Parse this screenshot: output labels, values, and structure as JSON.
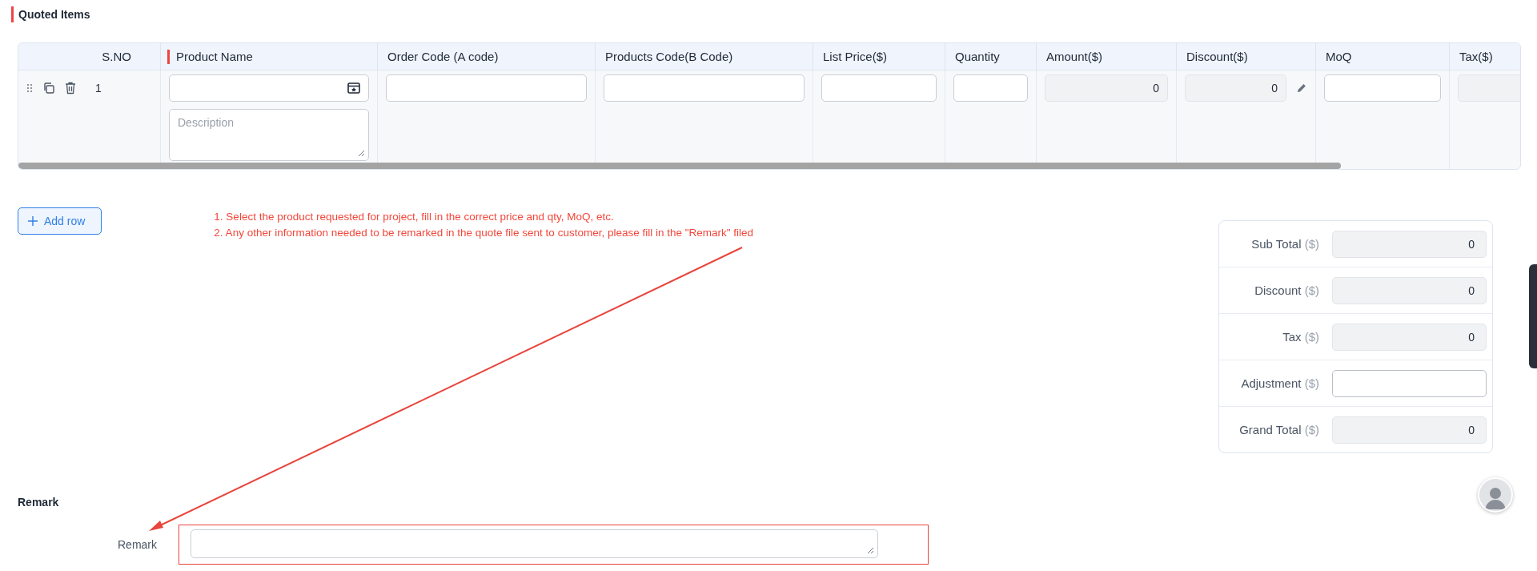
{
  "section_title": "Quoted Items",
  "table": {
    "columns": [
      {
        "label": "S.NO",
        "required": false
      },
      {
        "label": "Product Name",
        "required": true
      },
      {
        "label": "Order Code (A code)",
        "required": false
      },
      {
        "label": "Products Code(B Code)",
        "required": false
      },
      {
        "label": "List Price($)",
        "required": false
      },
      {
        "label": "Quantity",
        "required": false
      },
      {
        "label": "Amount($)",
        "required": false
      },
      {
        "label": "Discount($)",
        "required": false
      },
      {
        "label": "MoQ",
        "required": false
      },
      {
        "label": "Tax($)",
        "required": false
      }
    ],
    "rows": [
      {
        "cells": [
          {
            "kind": "sno",
            "value": "1"
          },
          {
            "kind": "product",
            "placeholder": "Description"
          },
          {
            "kind": "input"
          },
          {
            "kind": "input"
          },
          {
            "kind": "input"
          },
          {
            "kind": "input"
          },
          {
            "kind": "readonly",
            "value": "0"
          },
          {
            "kind": "discount",
            "value": "0"
          },
          {
            "kind": "input"
          },
          {
            "kind": "readonly"
          }
        ]
      }
    ]
  },
  "add_row_button": {
    "label": "Add row"
  },
  "annotation": {
    "lines": [
      "1. Select the product requested for project, fill in the correct price and qty, MoQ, etc.",
      "2. Any other information needed to be remarked in the quote file sent to customer, please fill in the \"Remark\" filed"
    ]
  },
  "totals": [
    {
      "label": "Sub Total",
      "unit": "($)",
      "value": "0",
      "editable": false
    },
    {
      "label": "Discount",
      "unit": "($)",
      "value": "0",
      "editable": false
    },
    {
      "label": "Tax",
      "unit": "($)",
      "value": "0",
      "editable": false
    },
    {
      "label": "Adjustment",
      "unit": "($)",
      "editable": true
    },
    {
      "label": "Grand Total",
      "unit": "($)",
      "value": "0",
      "editable": false
    }
  ],
  "remark_section": {
    "heading": "Remark",
    "label": "Remark"
  }
}
